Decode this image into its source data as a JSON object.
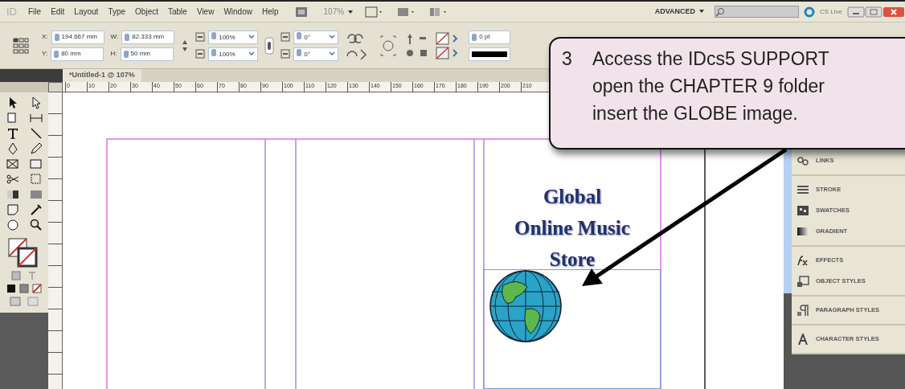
{
  "menu_bar": {
    "logo": "ID",
    "items": [
      "File",
      "Edit",
      "Layout",
      "Type",
      "Object",
      "Table",
      "View",
      "Window",
      "Help"
    ],
    "zoom": "107%",
    "workspace": "ADVANCED",
    "cs_live": "CS Live"
  },
  "control_panel": {
    "position_fields": [
      {
        "label": "X:",
        "value": "194.667 mm"
      },
      {
        "label": "Y:",
        "value": "80 mm"
      }
    ],
    "size_fields": [
      {
        "label": "W:",
        "value": "82.333 mm"
      },
      {
        "label": "H:",
        "value": "50 mm"
      }
    ],
    "scale_fields": [
      "100%",
      "100%"
    ],
    "angle_fields": [
      "0°",
      "0°"
    ],
    "stroke_weight": "0 pt"
  },
  "document_tab": {
    "title": "*Untitled-1 @ 107%"
  },
  "ruler": {
    "labels": [
      "0",
      "10",
      "20",
      "30",
      "40",
      "50",
      "60",
      "70",
      "80",
      "90",
      "100",
      "110",
      "120",
      "130",
      "140",
      "150",
      "160",
      "170",
      "180",
      "190",
      "200",
      "210"
    ]
  },
  "page": {
    "heading_lines": [
      "Global",
      "Online Music",
      "Store"
    ]
  },
  "panel_groups": [
    {
      "items": [
        {
          "label": "LINKS",
          "kind": "links"
        }
      ]
    },
    {
      "items": [
        {
          "label": "STROKE",
          "kind": "stroke"
        },
        {
          "label": "SWATCHES",
          "kind": "swatches"
        },
        {
          "label": "GRADIENT",
          "kind": "gradient"
        }
      ]
    },
    {
      "items": [
        {
          "label": "EFFECTS",
          "kind": "effects"
        },
        {
          "label": "OBJECT STYLES",
          "kind": "object"
        }
      ]
    },
    {
      "items": [
        {
          "label": "PARAGRAPH STYLES",
          "kind": "paragraph"
        }
      ]
    },
    {
      "items": [
        {
          "label": "CHARACTER STYLES",
          "kind": "character"
        }
      ]
    }
  ],
  "callout": {
    "number": "3",
    "lines": [
      "Access the IDcs5 SUPPORT",
      "open the CHAPTER 9 folder",
      "insert the GLOBE image."
    ]
  }
}
